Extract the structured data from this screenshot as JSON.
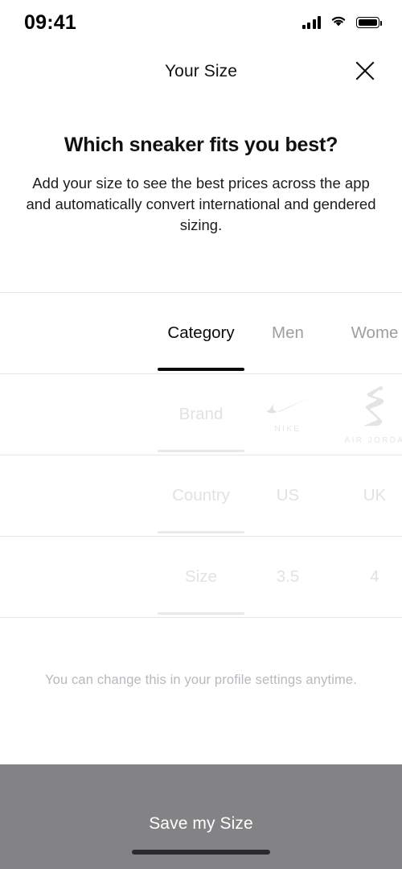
{
  "status_bar": {
    "time": "09:41",
    "cellular_icon": "signal-bars-icon",
    "wifi_icon": "wifi-icon",
    "battery_icon": "battery-full-icon"
  },
  "header": {
    "title": "Your Size",
    "close_icon": "close-icon"
  },
  "intro": {
    "heading": "Which sneaker fits you best?",
    "description": "Add your size to see the best prices across the app and automatically convert international and gendered sizing."
  },
  "picker": {
    "rows": [
      {
        "name": "category",
        "state": "active",
        "columns": [
          {
            "label": "Category",
            "selected": true
          },
          {
            "label": "Men",
            "selected": false
          },
          {
            "label": "Wome",
            "selected": false
          }
        ]
      },
      {
        "name": "brand",
        "state": "faded",
        "columns": [
          {
            "label": "Brand",
            "selected": true,
            "logo": null,
            "caption": null
          },
          {
            "label": "",
            "selected": false,
            "logo": "nike-swoosh-logo",
            "caption": "NIKE"
          },
          {
            "label": "",
            "selected": false,
            "logo": "air-jordan-jumpman-logo",
            "caption": "AIR JORDA"
          }
        ]
      },
      {
        "name": "country",
        "state": "faded",
        "columns": [
          {
            "label": "Country",
            "selected": true
          },
          {
            "label": "US",
            "selected": false
          },
          {
            "label": "UK",
            "selected": false
          }
        ]
      },
      {
        "name": "size",
        "state": "faded",
        "columns": [
          {
            "label": "Size",
            "selected": true
          },
          {
            "label": "3.5",
            "selected": false
          },
          {
            "label": "4",
            "selected": false
          }
        ]
      }
    ]
  },
  "note": "You can change this in your profile settings anytime.",
  "save_button": {
    "label": "Save my Size",
    "background": "#838385",
    "text_color": "#ffffff"
  },
  "home_indicator": "home-indicator"
}
